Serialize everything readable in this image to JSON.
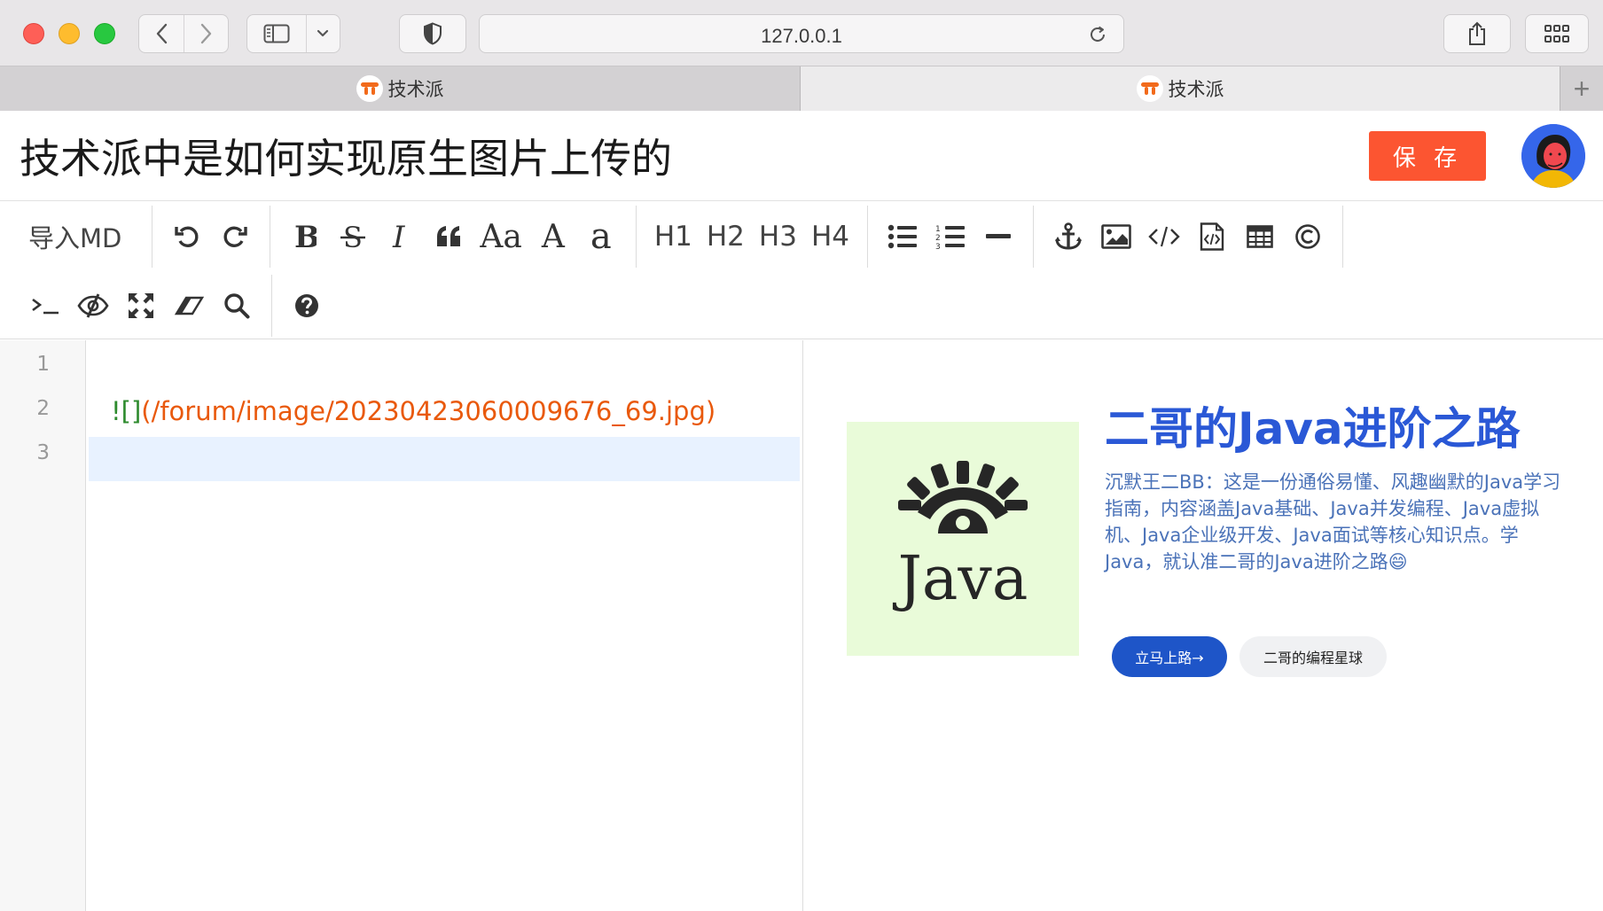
{
  "browser": {
    "url": "127.0.0.1",
    "tabs": [
      {
        "label": "技术派",
        "active": false
      },
      {
        "label": "技术派",
        "active": true
      }
    ],
    "new_tab_label": "+"
  },
  "page": {
    "title": "技术派中是如何实现原生图片上传的",
    "save_label": "保 存"
  },
  "toolbar": {
    "import_md": "导入MD",
    "style_labels": {
      "font_size": "Aa",
      "uppercase": "A",
      "lowercase": "a"
    },
    "headings": [
      "H1",
      "H2",
      "H3",
      "H4"
    ],
    "icons": [
      "undo-icon",
      "redo-icon",
      "bold-icon",
      "strikethrough-icon",
      "italic-icon",
      "quote-icon",
      "list-ul-icon",
      "list-ol-icon",
      "hr-icon",
      "anchor-icon",
      "image-icon",
      "code-icon",
      "code-block-icon",
      "table-icon",
      "copyright-icon",
      "terminal-icon",
      "eye-slash-icon",
      "fullscreen-icon",
      "eraser-icon",
      "search-icon",
      "help-icon"
    ]
  },
  "editor": {
    "line_numbers": [
      "1",
      "2",
      "3"
    ],
    "line2_bang": "![]",
    "line2_url": "(/forum/image/20230423060009676_69.jpg)"
  },
  "preview": {
    "image_text": "Java",
    "title": "二哥的Java进阶之路",
    "description": "沉默王二BB：这是一份通俗易懂、风趣幽默的Java学习指南，内容涵盖Java基础、Java并发编程、Java虚拟机、Java企业级开发、Java面试等核心知识点。学Java，就认准二哥的Java进阶之路😄",
    "primary_button": "立马上路→",
    "secondary_button": "二哥的编程星球"
  },
  "colors": {
    "accent": "#fc5531",
    "preview_title": "#2a58d6",
    "preview_desc": "#4a72b8",
    "primary_button": "#1e55c8",
    "active_line": "#e8f2ff",
    "image_bg": "#e9fbd9"
  }
}
